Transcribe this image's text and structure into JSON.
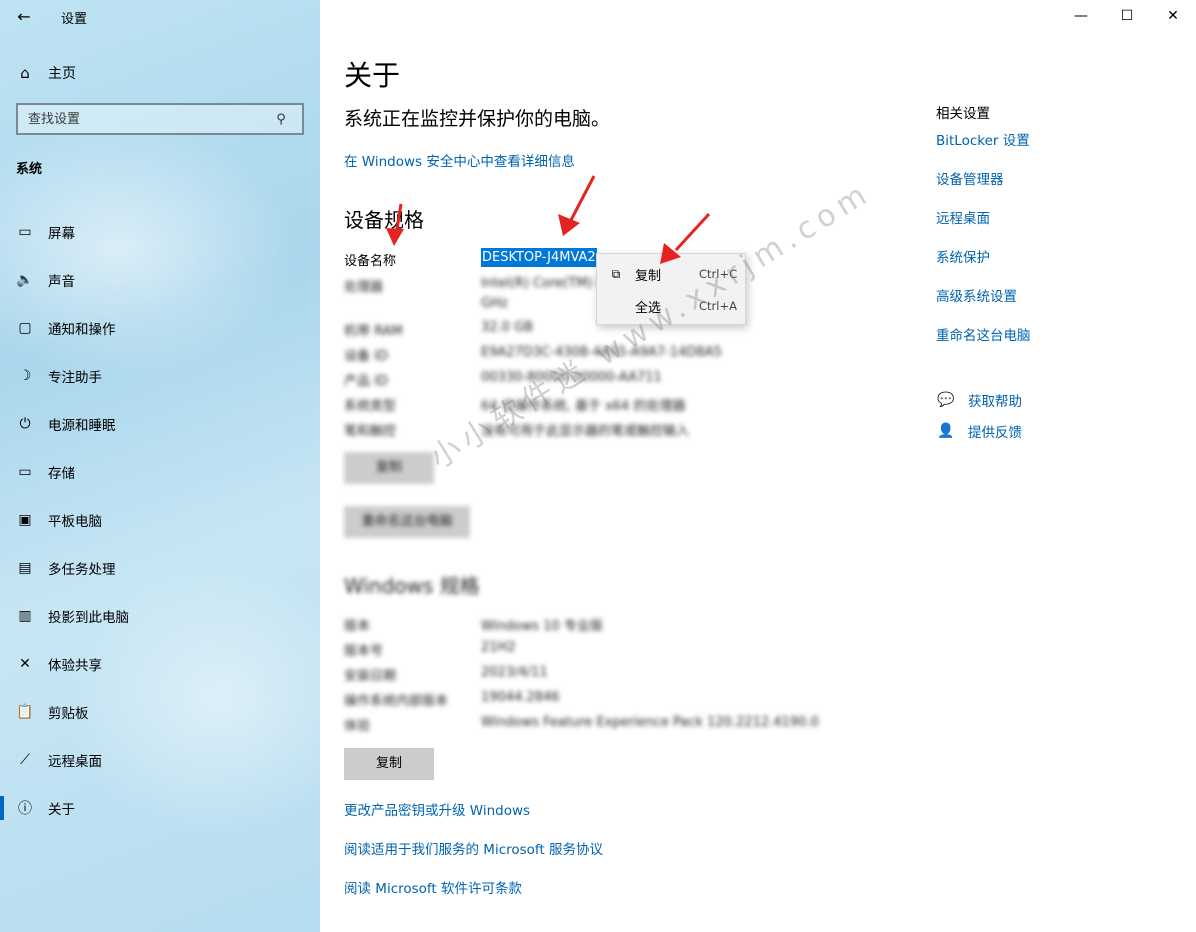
{
  "app": {
    "title": "设置",
    "back_icon": "back-arrow-icon"
  },
  "window_controls": {
    "minimize": "—",
    "maximize": "☐",
    "close": "✕"
  },
  "sidebar": {
    "home_label": "主页",
    "search_placeholder": "查找设置",
    "section_title": "系统",
    "items": [
      {
        "label": "屏幕",
        "icon": "display-icon",
        "glyph": "▭"
      },
      {
        "label": "声音",
        "icon": "sound-icon",
        "glyph": "🔈"
      },
      {
        "label": "通知和操作",
        "icon": "notification-icon",
        "glyph": "▢"
      },
      {
        "label": "专注助手",
        "icon": "focus-assist-icon",
        "glyph": "☽"
      },
      {
        "label": "电源和睡眠",
        "icon": "power-icon",
        "glyph": "⏻"
      },
      {
        "label": "存储",
        "icon": "storage-icon",
        "glyph": "▭"
      },
      {
        "label": "平板电脑",
        "icon": "tablet-icon",
        "glyph": "▣"
      },
      {
        "label": "多任务处理",
        "icon": "multitasking-icon",
        "glyph": "▤"
      },
      {
        "label": "投影到此电脑",
        "icon": "projecting-icon",
        "glyph": "▥"
      },
      {
        "label": "体验共享",
        "icon": "shared-experience-icon",
        "glyph": "✕"
      },
      {
        "label": "剪贴板",
        "icon": "clipboard-icon",
        "glyph": "📋"
      },
      {
        "label": "远程桌面",
        "icon": "remote-desktop-icon",
        "glyph": "⟋"
      },
      {
        "label": "关于",
        "icon": "info-icon",
        "glyph": "ⓘ"
      }
    ],
    "active_index": 12
  },
  "main": {
    "title": "关于",
    "protect_text": "系统正在监控并保护你的电脑。",
    "security_link": "在 Windows 安全中心中查看详细信息",
    "device_spec_title": "设备规格",
    "device_name_label": "设备名称",
    "device_name_value": "DESKTOP-J4MVA2",
    "device_specs": [
      {
        "k": "处理器",
        "v": "Intel(R) Core(TM) i7 CPU 3.40"
      },
      {
        "k": "",
        "v": "GHz"
      },
      {
        "k": "机带 RAM",
        "v": "32.0 GB"
      },
      {
        "k": "设备 ID",
        "v": "E9A27D3C-4308-4A55-A9A7-14D8A5"
      },
      {
        "k": "产品 ID",
        "v": "00330-80000-00000-AA711"
      },
      {
        "k": "系统类型",
        "v": "64 位操作系统, 基于 x64 的处理器"
      },
      {
        "k": "笔和触控",
        "v": "没有可用于此显示器的笔或触控输入"
      }
    ],
    "copy_button_1": "复制",
    "rename_button": "重命名这台电脑",
    "windows_spec_title": "Windows 规格",
    "windows_specs": [
      {
        "k": "版本",
        "v": "Windows 10 专业版"
      },
      {
        "k": "版本号",
        "v": "21H2"
      },
      {
        "k": "安装日期",
        "v": "2023/4/11"
      },
      {
        "k": "操作系统内部版本",
        "v": "19044.2846"
      },
      {
        "k": "体验",
        "v": "Windows Feature Experience Pack 120.2212.4190.0"
      }
    ],
    "copy_button_2": "复制",
    "links": [
      "更改产品密钥或升级 Windows",
      "阅读适用于我们服务的 Microsoft 服务协议",
      "阅读 Microsoft 软件许可条款"
    ]
  },
  "context_menu": {
    "items": [
      {
        "label": "复制",
        "shortcut": "Ctrl+C",
        "icon": "copy-icon",
        "glyph": "⧉"
      },
      {
        "label": "全选",
        "shortcut": "Ctrl+A",
        "icon": "",
        "glyph": ""
      }
    ]
  },
  "related": {
    "title": "相关设置",
    "links": [
      "BitLocker 设置",
      "设备管理器",
      "远程桌面",
      "系统保护",
      "高级系统设置",
      "重命名这台电脑"
    ],
    "help": [
      {
        "label": "获取帮助",
        "icon": "help-chat-icon",
        "glyph": "💬"
      },
      {
        "label": "提供反馈",
        "icon": "feedback-icon",
        "glyph": "👤"
      }
    ]
  },
  "watermark": "小小软件迷 www.xxrjm.com",
  "accent_color": "#0063b1",
  "arrow_color": "#e52320"
}
